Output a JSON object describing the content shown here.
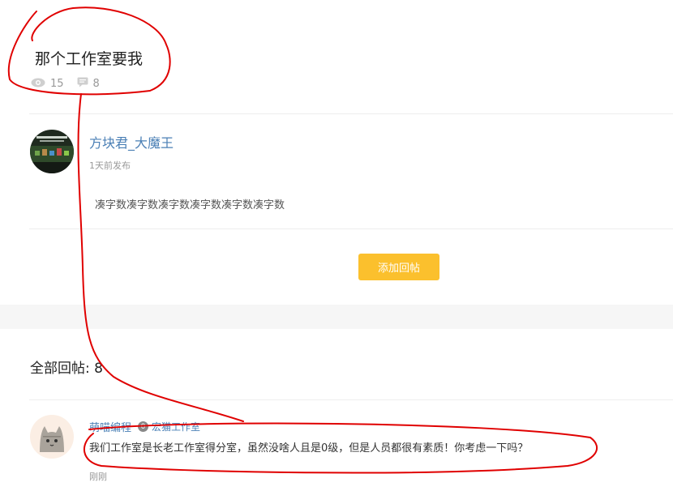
{
  "post": {
    "title": "那个工作室要我",
    "views": "15",
    "comments": "8",
    "author": "方块君_大魔王",
    "time": "1天前发布",
    "body": "凑字数凑字数凑字数凑字数凑字数凑字数"
  },
  "actions": {
    "add_reply": "添加回帖"
  },
  "replies": {
    "heading": "全部回帖: 8",
    "items": [
      {
        "author": "萌喵编程",
        "studio_badge": "0",
        "studio": "宏猫工作室",
        "text": "我们工作室是长老工作室得分室，虽然没啥人且是0级，但是人员都很有素质！你考虑一下吗？",
        "time": "刚刚"
      }
    ]
  },
  "colors": {
    "accent": "#fbc02d",
    "link": "#4a7fb5",
    "annotation": "#e00000"
  }
}
